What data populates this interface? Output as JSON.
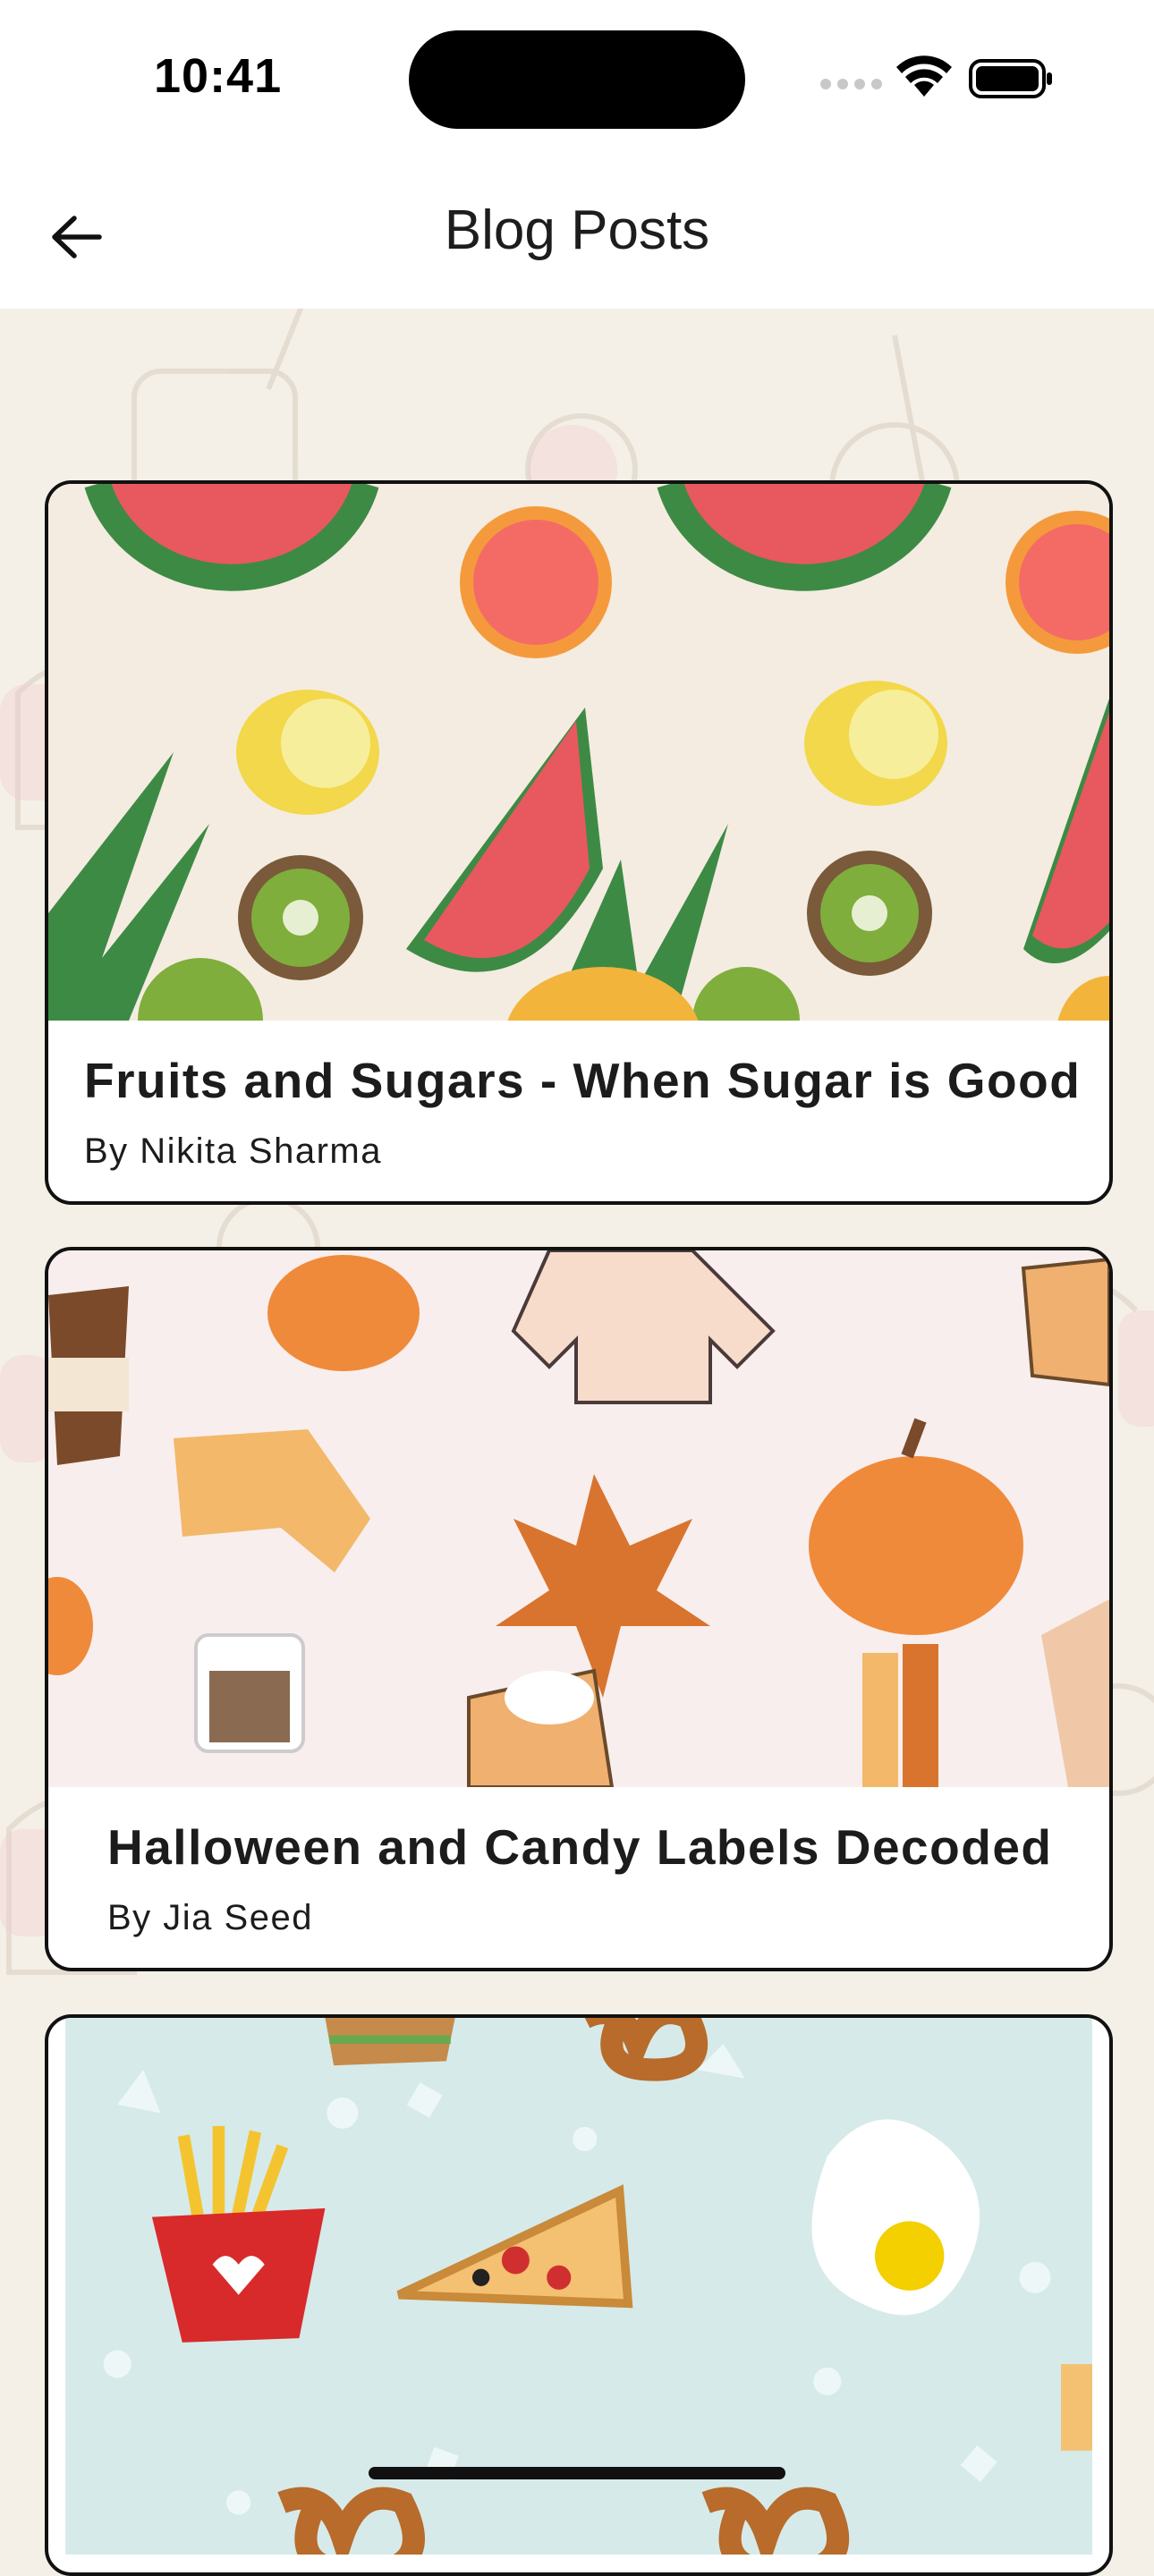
{
  "status": {
    "time": "10:41"
  },
  "nav": {
    "title": "Blog Posts"
  },
  "posts": [
    {
      "title": "Fruits and Sugars - When Sugar is Good",
      "author": "By Nikita Sharma"
    },
    {
      "title": "Halloween and Candy Labels Decoded",
      "author": "By Jia Seed"
    },
    {
      "title": "",
      "author": ""
    }
  ],
  "icons": {
    "back": "arrow-left-icon",
    "wifi": "wifi-icon",
    "battery": "battery-icon",
    "signal": "signal-icon"
  },
  "colors": {
    "page_bg": "#f4f0e7",
    "card_border": "#111111",
    "card2_bg": "#f8eeed",
    "card3_bg": "#d6eaea",
    "card1_bg": "#f4ece0"
  }
}
